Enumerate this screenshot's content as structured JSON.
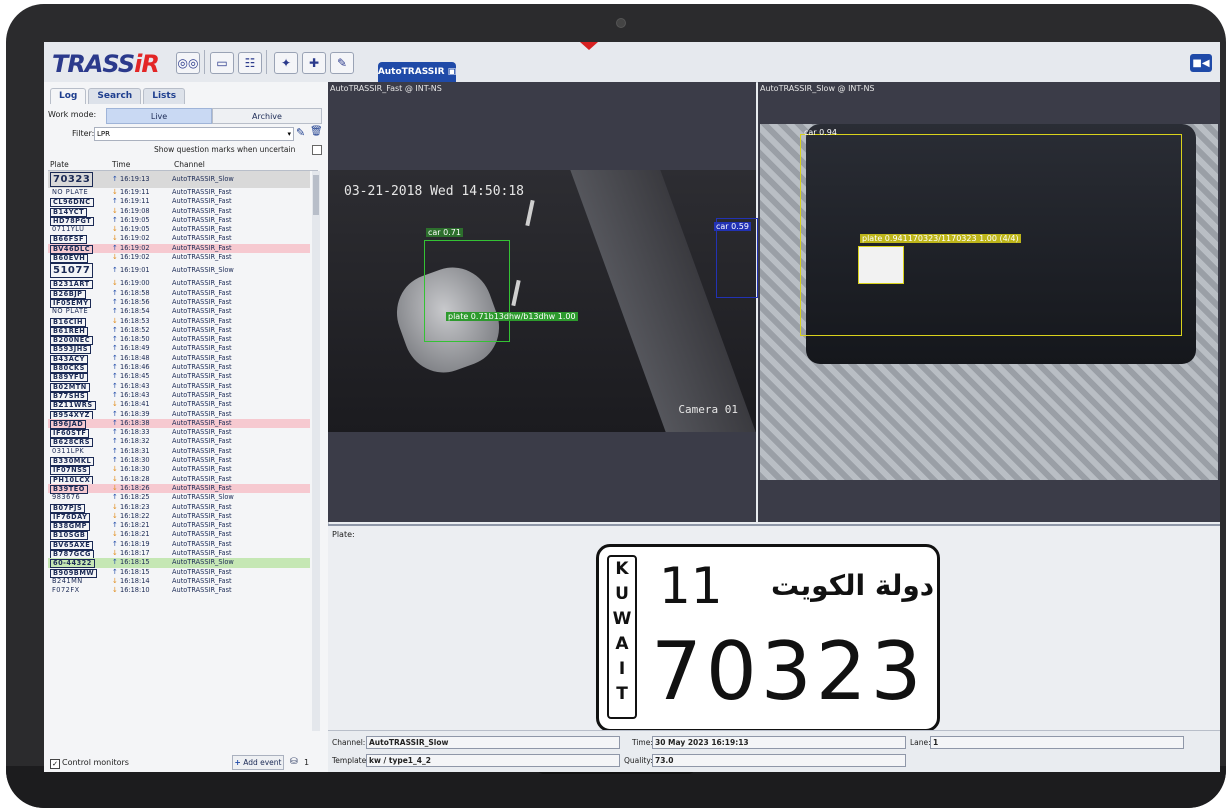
{
  "app": {
    "logo_main": "TRASS",
    "logo_accent": "iR",
    "tab_title": "AutoTRASSIR"
  },
  "toolbar": {
    "icons": [
      "tape-icon",
      "chat-icon",
      "layout-icon",
      "wand-icon",
      "puzzle-icon",
      "edit-icon"
    ]
  },
  "left": {
    "tabs": [
      "Log",
      "Search",
      "Lists"
    ],
    "work_mode_label": "Work mode:",
    "live_label": "Live",
    "archive_label": "Archive",
    "filter_label": "Filter:",
    "filter_value": "LPR",
    "question_marks_label": "Show question marks when uncertain",
    "columns": [
      "Plate",
      "Time",
      "Channel"
    ],
    "control_monitors_label": "Control monitors",
    "add_event_label": "Add event",
    "db_count": "1",
    "rows": [
      {
        "plate": "70323",
        "time": "16:19:13",
        "channel": "AutoTRASSIR_Slow",
        "dir": "up",
        "style": "sel",
        "big": true
      },
      {
        "plate": "NO PLATE",
        "time": "16:19:11",
        "channel": "AutoTRASSIR_Fast",
        "dir": "down",
        "plain": true
      },
      {
        "plate": "CL96DNC",
        "time": "16:19:11",
        "channel": "AutoTRASSIR_Fast",
        "dir": "up"
      },
      {
        "plate": "B14YCT",
        "time": "16:19:08",
        "channel": "AutoTRASSIR_Fast",
        "dir": "down"
      },
      {
        "plate": "HD78PGT",
        "time": "16:19:05",
        "channel": "AutoTRASSIR_Fast",
        "dir": "up"
      },
      {
        "plate": "0711YLU",
        "time": "16:19:05",
        "channel": "AutoTRASSIR_Fast",
        "dir": "down",
        "plain": true
      },
      {
        "plate": "B66FSF",
        "time": "16:19:02",
        "channel": "AutoTRASSIR_Fast",
        "dir": "down"
      },
      {
        "plate": "BV46DLC",
        "time": "16:19:02",
        "channel": "AutoTRASSIR_Fast",
        "dir": "up",
        "style": "pink"
      },
      {
        "plate": "B60EVH",
        "time": "16:19:02",
        "channel": "AutoTRASSIR_Fast",
        "dir": "down"
      },
      {
        "plate": "51077",
        "time": "16:19:01",
        "channel": "AutoTRASSIR_Slow",
        "dir": "up",
        "big": true
      },
      {
        "plate": "B231ART",
        "time": "16:19:00",
        "channel": "AutoTRASSIR_Fast",
        "dir": "down"
      },
      {
        "plate": "B26BJP",
        "time": "16:18:58",
        "channel": "AutoTRASSIR_Fast",
        "dir": "up"
      },
      {
        "plate": "IF05EMY",
        "time": "16:18:56",
        "channel": "AutoTRASSIR_Fast",
        "dir": "up"
      },
      {
        "plate": "NO PLATE",
        "time": "16:18:54",
        "channel": "AutoTRASSIR_Fast",
        "dir": "up",
        "plain": true
      },
      {
        "plate": "B16CIH",
        "time": "16:18:53",
        "channel": "AutoTRASSIR_Fast",
        "dir": "down"
      },
      {
        "plate": "B61REH",
        "time": "16:18:52",
        "channel": "AutoTRASSIR_Fast",
        "dir": "up"
      },
      {
        "plate": "B200NEC",
        "time": "16:18:50",
        "channel": "AutoTRASSIR_Fast",
        "dir": "up"
      },
      {
        "plate": "B593JHS",
        "time": "16:18:49",
        "channel": "AutoTRASSIR_Fast",
        "dir": "up"
      },
      {
        "plate": "B43ACY",
        "time": "16:18:48",
        "channel": "AutoTRASSIR_Fast",
        "dir": "up"
      },
      {
        "plate": "B80CKS",
        "time": "16:18:46",
        "channel": "AutoTRASSIR_Fast",
        "dir": "up"
      },
      {
        "plate": "B89YFU",
        "time": "16:18:45",
        "channel": "AutoTRASSIR_Fast",
        "dir": "up"
      },
      {
        "plate": "B02MTN",
        "time": "16:18:43",
        "channel": "AutoTRASSIR_Fast",
        "dir": "up"
      },
      {
        "plate": "B77SHS",
        "time": "16:18:43",
        "channel": "AutoTRASSIR_Fast",
        "dir": "up"
      },
      {
        "plate": "BZ11WRS",
        "time": "16:18:41",
        "channel": "AutoTRASSIR_Fast",
        "dir": "down"
      },
      {
        "plate": "B954XYZ",
        "time": "16:18:39",
        "channel": "AutoTRASSIR_Fast",
        "dir": "up"
      },
      {
        "plate": "B96JAD",
        "time": "16:18:38",
        "channel": "AutoTRASSIR_Fast",
        "dir": "up",
        "style": "pink"
      },
      {
        "plate": "IF60STF",
        "time": "16:18:33",
        "channel": "AutoTRASSIR_Fast",
        "dir": "up"
      },
      {
        "plate": "B628CRS",
        "time": "16:18:32",
        "channel": "AutoTRASSIR_Fast",
        "dir": "up"
      },
      {
        "plate": "0311LPK",
        "time": "16:18:31",
        "channel": "AutoTRASSIR_Fast",
        "dir": "up",
        "plain": true
      },
      {
        "plate": "B330MKL",
        "time": "16:18:30",
        "channel": "AutoTRASSIR_Fast",
        "dir": "up"
      },
      {
        "plate": "IF07NSS",
        "time": "16:18:30",
        "channel": "AutoTRASSIR_Fast",
        "dir": "down"
      },
      {
        "plate": "PH10LCX",
        "time": "16:18:28",
        "channel": "AutoTRASSIR_Fast",
        "dir": "down"
      },
      {
        "plate": "B39TEO",
        "time": "16:18:26",
        "channel": "AutoTRASSIR_Fast",
        "dir": "down",
        "style": "pink"
      },
      {
        "plate": "983676",
        "time": "16:18:25",
        "channel": "AutoTRASSIR_Slow",
        "dir": "up",
        "plain": true
      },
      {
        "plate": "B07PJS",
        "time": "16:18:23",
        "channel": "AutoTRASSIR_Fast",
        "dir": "down"
      },
      {
        "plate": "IF76DAY",
        "time": "16:18:22",
        "channel": "AutoTRASSIR_Fast",
        "dir": "down"
      },
      {
        "plate": "B38GMP",
        "time": "16:18:21",
        "channel": "AutoTRASSIR_Fast",
        "dir": "up"
      },
      {
        "plate": "B10SGB",
        "time": "16:18:21",
        "channel": "AutoTRASSIR_Fast",
        "dir": "down"
      },
      {
        "plate": "BV65AXE",
        "time": "16:18:19",
        "channel": "AutoTRASSIR_Fast",
        "dir": "up"
      },
      {
        "plate": "B787GCG",
        "time": "16:18:17",
        "channel": "AutoTRASSIR_Fast",
        "dir": "down"
      },
      {
        "plate": "60-44322",
        "time": "16:18:15",
        "channel": "AutoTRASSIR_Slow",
        "dir": "up",
        "style": "green"
      },
      {
        "plate": "B909BMW",
        "time": "16:18:15",
        "channel": "AutoTRASSIR_Fast",
        "dir": "up"
      },
      {
        "plate": "B241MN",
        "time": "16:18:14",
        "channel": "AutoTRASSIR_Fast",
        "dir": "down",
        "plain": true
      },
      {
        "plate": "F072FX",
        "time": "16:18:10",
        "channel": "AutoTRASSIR_Fast",
        "dir": "down",
        "plain": true
      }
    ]
  },
  "video_fast": {
    "title": "AutoTRASSIR_Fast @ INT-NS",
    "timestamp": "03-21-2018 Wed 14:50:18",
    "camera_label": "Camera 01",
    "car_label": "car 0.71",
    "car2_label": "car 0.59",
    "plate_label": "plate 0.71b13dhw/b13dhw 1.00"
  },
  "video_slow": {
    "title": "AutoTRASSIR_Slow @ INT-NS",
    "car_label": "car 0.94",
    "plate_label": "plate 0.941170323/1170323 1.00 (4/4)"
  },
  "plate_panel": {
    "label": "Plate:",
    "country_letters": [
      "K",
      "U",
      "W",
      "A",
      "I",
      "T"
    ],
    "number_top": "11",
    "arabic_text": "دولة الكويت",
    "number_main": "70323"
  },
  "info": {
    "channel_label": "Channel:",
    "channel_value": "AutoTRASSIR_Slow",
    "time_label": "Time:",
    "time_value": "30 May 2023 16:19:13",
    "lane_label": "Lane:",
    "lane_value": "1",
    "template_label": "Template:",
    "template_value": "kw / type1_4_2",
    "quality_label": "Quality:",
    "quality_value": "73.0"
  },
  "colors": {
    "accent": "#1f4aa8",
    "logo_blue": "#2b3a8c",
    "logo_red": "#e32626",
    "box_green": "#34c234",
    "box_yellow": "#d9d21c"
  }
}
